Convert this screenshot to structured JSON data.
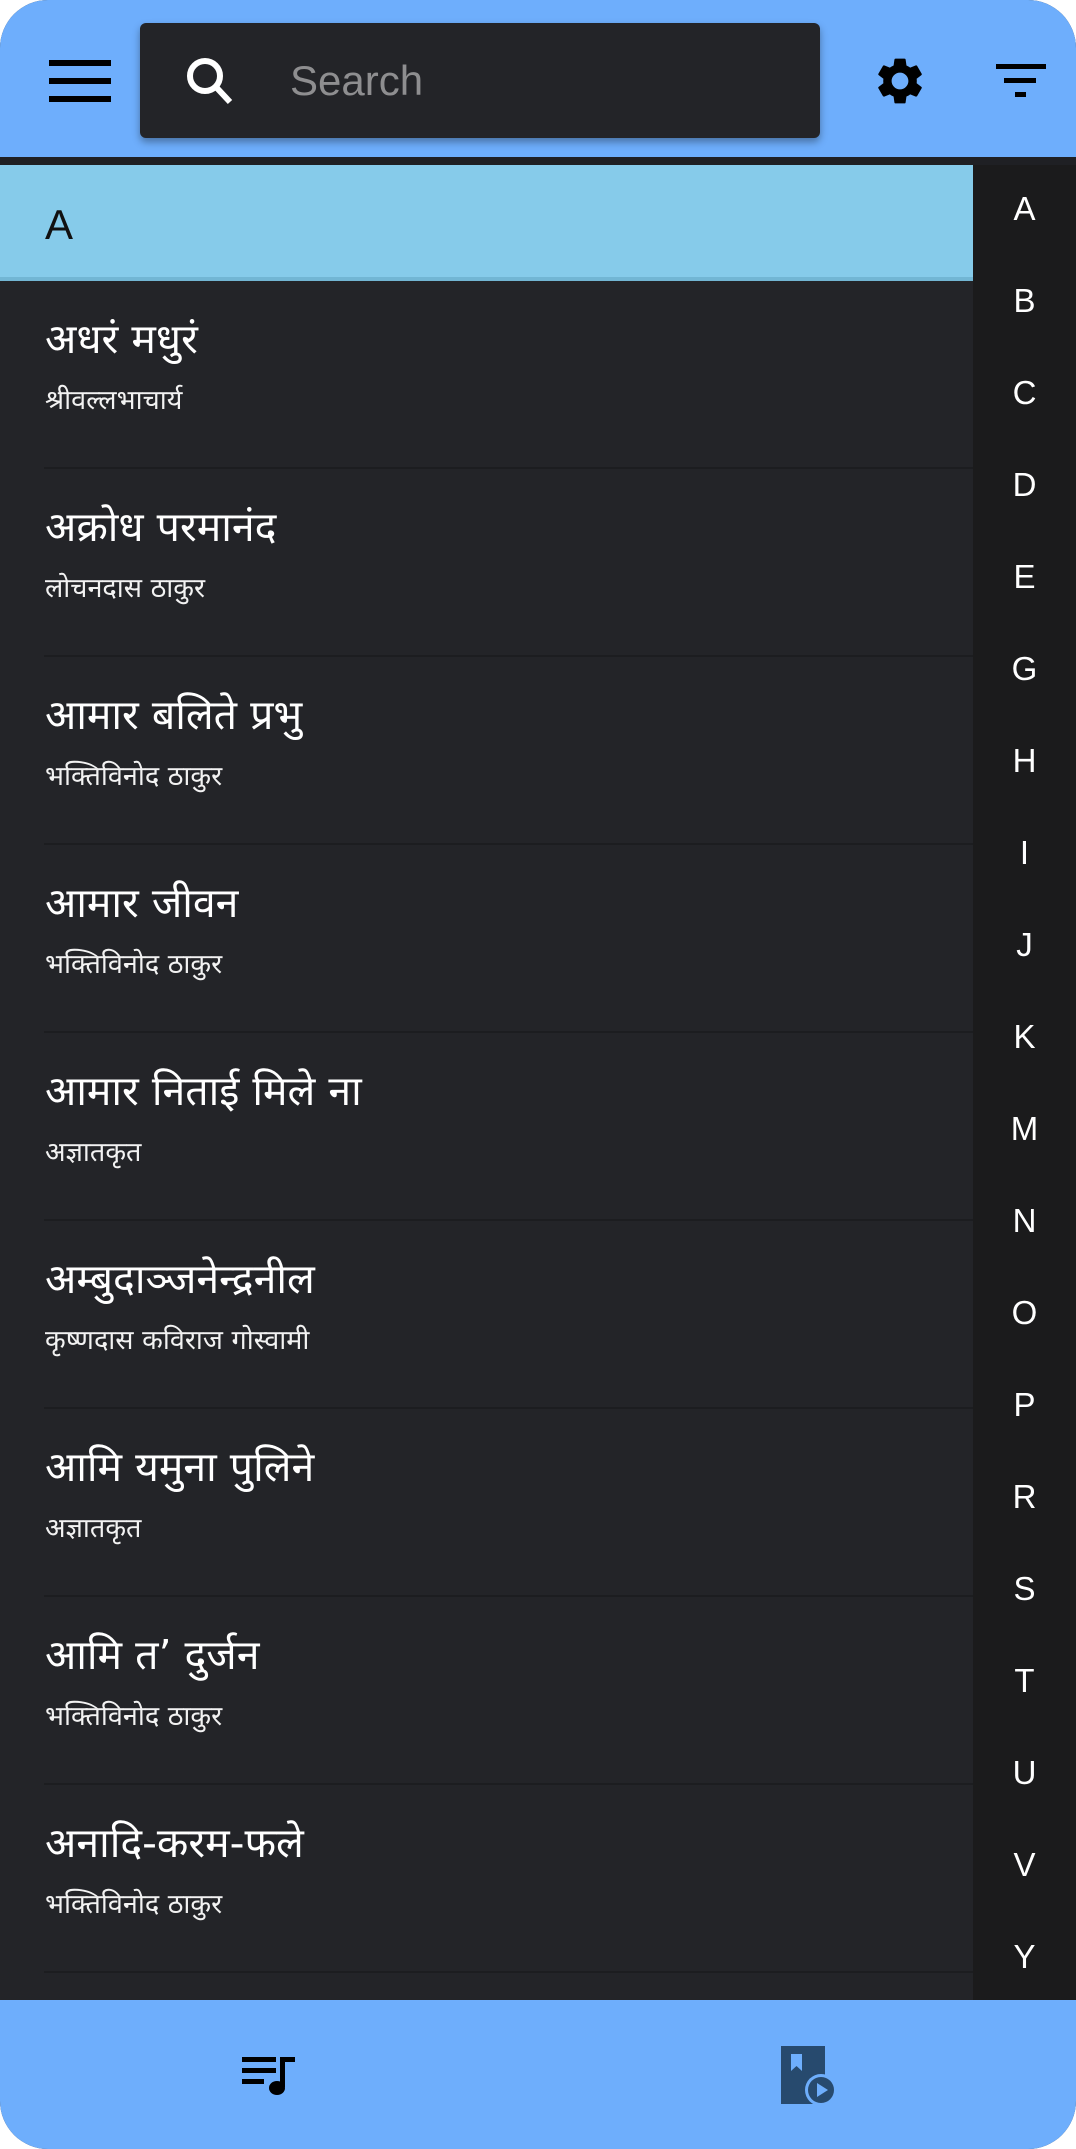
{
  "app_bar": {
    "menu_icon": "menu-icon",
    "search": {
      "placeholder": "Search",
      "value": "",
      "icon": "search-icon"
    },
    "settings_icon": "gear-icon",
    "filter_icon": "filter-icon"
  },
  "section": {
    "label": "A"
  },
  "songs": [
    {
      "title": "अधरं मधुरं",
      "author": "श्रीवल्लभाचार्य"
    },
    {
      "title": "अक्रोध परमानंद",
      "author": "लोचनदास ठाकुर"
    },
    {
      "title": "आमार बलिते प्रभु",
      "author": "भक्तिविनोद ठाकुर"
    },
    {
      "title": "आमार जीवन",
      "author": "भक्तिविनोद ठाकुर"
    },
    {
      "title": "आमार निताई मिले ना",
      "author": "अज्ञातकृत"
    },
    {
      "title": "अम्बुदाञ्जनेन्द्रनील",
      "author": "कृष्णदास कविराज गोस्वामी"
    },
    {
      "title": "आमि यमुना पुलिने",
      "author": "अज्ञातकृत"
    },
    {
      "title": "आमि त’ दुर्जन",
      "author": "भक्तिविनोद ठाकुर"
    },
    {
      "title": "अनादि-करम-फले",
      "author": "भक्तिविनोद ठाकुर"
    }
  ],
  "index_letters": [
    "A",
    "B",
    "C",
    "D",
    "E",
    "G",
    "H",
    "I",
    "J",
    "K",
    "M",
    "N",
    "O",
    "P",
    "R",
    "S",
    "T",
    "U",
    "V",
    "Y"
  ],
  "bottom_nav": {
    "items": [
      {
        "icon": "playlist-music-icon",
        "active": true
      },
      {
        "icon": "book-play-icon",
        "active": false
      }
    ]
  },
  "colors": {
    "app_bar": "#6EAEFC",
    "section_header": "#86CBEA",
    "list_background": "#232428",
    "index_background": "#1B1B1C",
    "nav_icon_inactive": "#274A6E"
  }
}
